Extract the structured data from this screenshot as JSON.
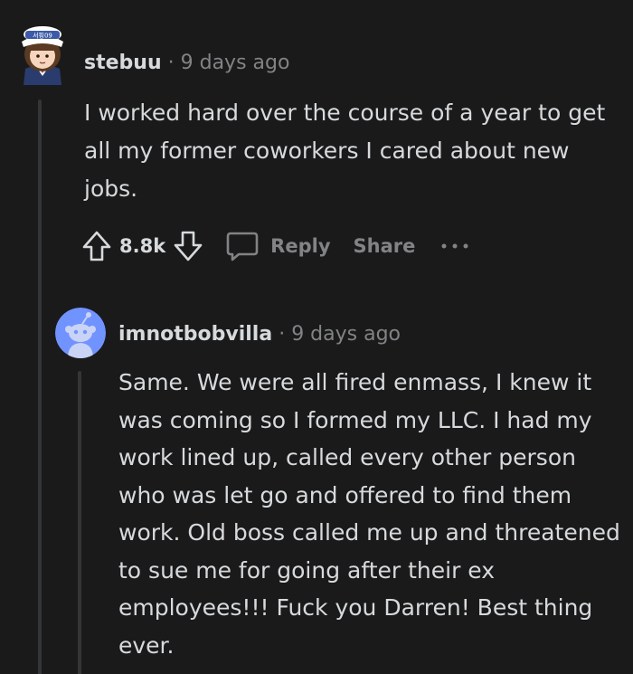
{
  "comment": {
    "username": "stebuu",
    "separator": "·",
    "timestamp": "9 days ago",
    "body": "I worked hard over the course of a year to get all my former coworkers I cared about new jobs.",
    "score": "8.8k",
    "reply_label": "Reply",
    "share_label": "Share",
    "avatar_badge_text": "서핑09",
    "icons": [
      "upvote-icon",
      "downvote-icon",
      "comment-icon",
      "more-icon"
    ]
  },
  "reply": {
    "username": "imnotbobvilla",
    "separator": "·",
    "timestamp": "9 days ago",
    "body": "Same. We were all fired enmass, I knew it was coming so I formed my LLC. I had my work lined up, called every other person who was let go and offered to find them work. Old boss called me up and threatened to sue me for going after their ex employees!!! Fuck you Darren! Best thing ever.",
    "avatar_icon": "snoo-avatar-icon"
  },
  "colors": {
    "background": "#1a1a1b",
    "text": "#d7dadc",
    "muted": "#818384",
    "thread_line": "#343536",
    "avatar_blue": "#7193ff"
  }
}
